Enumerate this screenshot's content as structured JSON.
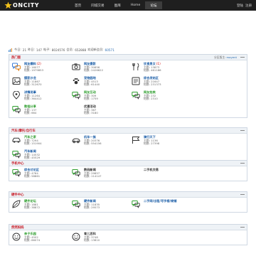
{
  "brand": "ONCITY",
  "nav": [
    "首页",
    "同城交易",
    "图库",
    "Home",
    "论坛"
  ],
  "toplinks": [
    "登陆",
    "注册"
  ],
  "stats": {
    "today_label": "今日:",
    "today": "21",
    "yesterday_label": "昨日:",
    "yesterday": "147",
    "posts_label": "帖子:",
    "posts": "8024576",
    "members_label": "会员:",
    "members": "652888",
    "newest_label": "欢迎新会员:",
    "newest": "60571"
  },
  "sections": [
    {
      "title": "热门版",
      "moderator_label": "分区版主:",
      "moderator": "mayent",
      "forums": [
        {
          "name": "网友爆料",
          "new": "(2)",
          "topics_label": "主题:",
          "topics": "16077",
          "posts_label": "帖数:",
          "posts": "1979853",
          "icon": "bubbles-icon",
          "style": "blue"
        },
        {
          "name": "网友摄影",
          "new": "",
          "topics_label": "主题:",
          "topics": "30656",
          "posts_label": "帖数:",
          "posts": "2426622",
          "icon": "camera-icon",
          "style": "blue"
        },
        {
          "name": "饮食男女",
          "new": "(1)",
          "topics_label": "主题:",
          "topics": "13873",
          "posts_label": "帖数:",
          "posts": "461186",
          "icon": "fork-knife-icon",
          "style": "blue"
        },
        {
          "name": "摄影沙龙",
          "new": "",
          "topics_label": "主题:",
          "topics": "11867",
          "posts_label": "帖数:",
          "posts": "312670",
          "icon": "photo-icon",
          "style": "blue"
        },
        {
          "name": "宠物园地",
          "new": "",
          "topics_label": "主题:",
          "topics": "4513",
          "posts_label": "帖数:",
          "posts": "61440",
          "icon": "paw-icon",
          "style": "blue"
        },
        {
          "name": "综合发帖区",
          "new": "",
          "topics_label": "主题:",
          "topics": "21647",
          "posts_label": "帖数:",
          "posts": "231373",
          "icon": "post-icon",
          "style": "blue"
        },
        {
          "name": "讲情说事",
          "new": "",
          "topics_label": "主题:",
          "topics": "11264",
          "posts_label": "帖数:",
          "posts": "364412",
          "icon": "location-icon",
          "style": "blue"
        },
        {
          "name": "网友互动",
          "new": "",
          "topics_label": "主题:",
          "topics": "309",
          "posts_label": "帖数:",
          "posts": "1759",
          "icon": "chat-icon",
          "style": "green"
        },
        {
          "name": "网友拍卖",
          "new": "",
          "topics_label": "主题:",
          "topics": "232",
          "posts_label": "帖数:",
          "posts": "2310",
          "icon": "chat-icon",
          "style": "green"
        },
        {
          "name": "教程分享",
          "new": "",
          "topics_label": "主题:",
          "topics": "137",
          "posts_label": "帖数:",
          "posts": "664",
          "icon": "chat-icon",
          "style": "green"
        },
        {
          "name": "优惠活动",
          "new": "",
          "topics_label": "主题:",
          "topics": "387",
          "posts_label": "帖数:",
          "posts": "3180",
          "icon": "",
          "style": "dark"
        }
      ]
    },
    {
      "title": "汽车/摩托/自行车",
      "moderator_label": "",
      "moderator": "",
      "forums": [
        {
          "name": "汽车之家",
          "new": "",
          "topics_label": "主题:",
          "topics": "7294",
          "posts_label": "帖数:",
          "posts": "151904",
          "icon": "car-icon",
          "style": "green"
        },
        {
          "name": "机车一族",
          "new": "",
          "topics_label": "主题:",
          "topics": "20376",
          "posts_label": "帖数:",
          "posts": "554156",
          "icon": "motorbike-icon",
          "style": "blue"
        },
        {
          "name": "骑行天下",
          "new": "",
          "topics_label": "主题:",
          "topics": "1136",
          "posts_label": "帖数:",
          "posts": "27398",
          "icon": "bike-flag-icon",
          "style": "blue"
        },
        {
          "name": "汽车新闻",
          "new": "",
          "topics_label": "主题:",
          "topics": "14532",
          "posts_label": "帖数:",
          "posts": "45529",
          "icon": "chat-icon",
          "style": "blue"
        }
      ]
    },
    {
      "title": "手机中心",
      "moderator_label": "",
      "moderator": "",
      "forums": [
        {
          "name": "综合讨论区",
          "new": "",
          "topics_label": "主题:",
          "topics": "4764",
          "posts_label": "帖数:",
          "posts": "58861",
          "icon": "chat-icon",
          "style": "blue"
        },
        {
          "name": "数码新闻",
          "new": "",
          "topics_label": "主题:",
          "topics": "29857",
          "posts_label": "帖数:",
          "posts": "114147",
          "icon": "chat-icon",
          "style": "dark"
        },
        {
          "name": "二手机交易",
          "new": "",
          "topics_label": "",
          "topics": "",
          "posts_label": "",
          "posts": "",
          "icon": "",
          "style": "dark"
        }
      ]
    },
    {
      "title": "硬件中心",
      "moderator_label": "",
      "moderator": "",
      "forums": [
        {
          "name": "硬件论坛",
          "new": "",
          "topics_label": "主题:",
          "topics": "1881",
          "posts_label": "帖数:",
          "posts": "38872",
          "icon": "leaf-icon",
          "style": "green"
        },
        {
          "name": "硬件新闻",
          "new": "",
          "topics_label": "主题:",
          "topics": "11835",
          "posts_label": "帖数:",
          "posts": "29573",
          "icon": "chat-icon",
          "style": "blue"
        },
        {
          "name": "二手网/出租/写字楼/商铺",
          "new": "",
          "topics_label": "",
          "topics": "",
          "posts_label": "",
          "posts": "",
          "icon": "chat-icon",
          "style": "blue"
        }
      ]
    },
    {
      "title": "然然妈妈",
      "moderator_label": "",
      "moderator": "",
      "forums": [
        {
          "name": "亲子乐园",
          "new": "",
          "topics_label": "主题:",
          "topics": "4502",
          "posts_label": "帖数:",
          "posts": "86074",
          "icon": "smile-icon",
          "style": "green"
        },
        {
          "name": "育儿百科",
          "new": "",
          "topics_label": "主题:",
          "topics": "3748",
          "posts_label": "帖数:",
          "posts": "13810",
          "icon": "smile-icon",
          "style": "dark"
        }
      ]
    }
  ]
}
